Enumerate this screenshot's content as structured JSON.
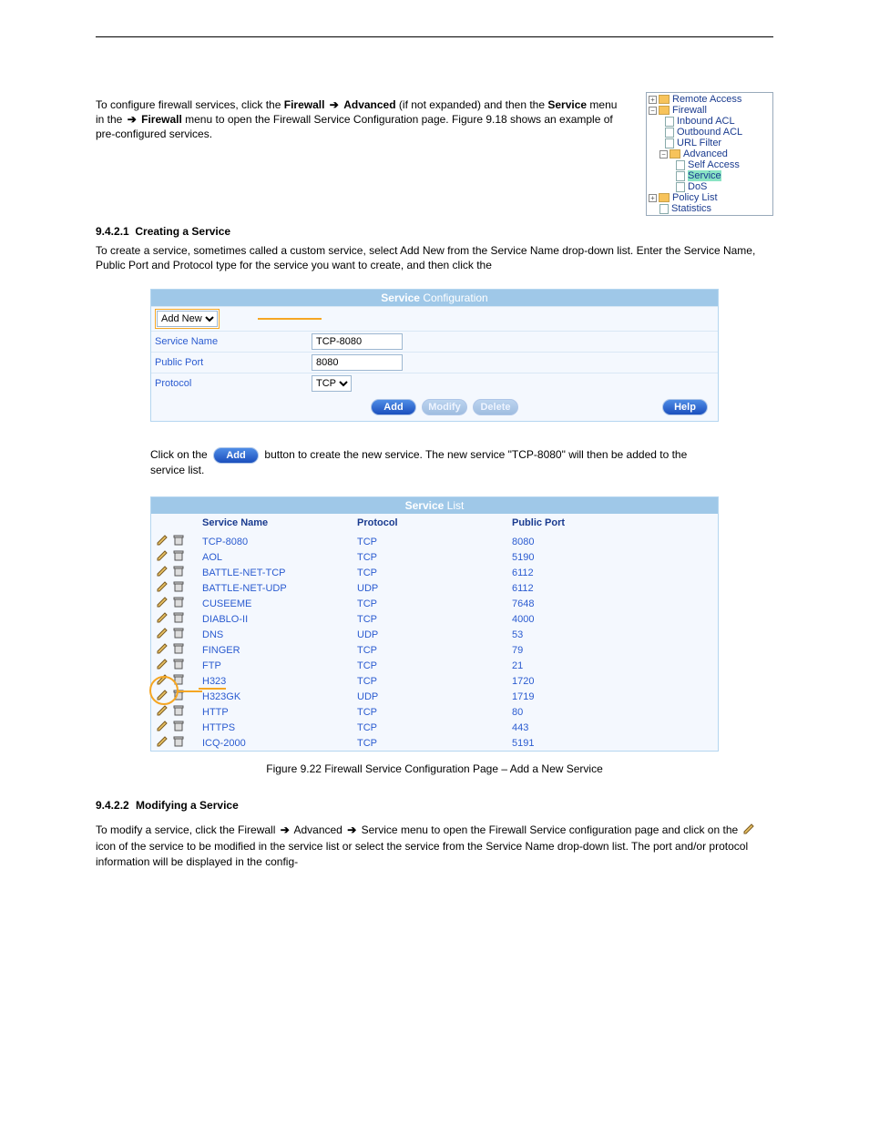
{
  "section": {
    "id": "9.4.2.1",
    "title": "Creating a Service",
    "para": "To create a service, sometimes called a custom service, select Add New from the Service Name drop-down list. Enter the Service Name, Public Port and Protocol type for the service you want to create, and then click the"
  },
  "tree": {
    "remote_access": "Remote Access",
    "firewall": "Firewall",
    "inbound_acl": "Inbound ACL",
    "outbound_acl": "Outbound ACL",
    "url_filter": "URL Filter",
    "advanced": "Advanced",
    "self_access": "Self Access",
    "service": "Service",
    "dos": "DoS",
    "policy_list": "Policy List",
    "statistics": "Statistics"
  },
  "intro": {
    "line1_a": "To configure firewall services, click the",
    "line1_b": "(if not expanded) and then the",
    "line1_c": "menu in the",
    "line2_a": "menu to open the Firewall Service Configuration page. Figure 9.18 shows an example of pre-configured services.",
    "firewall": "Firewall",
    "advanced": "Advanced",
    "service": "Service"
  },
  "config_panel": {
    "title_strong": "Service",
    "title_thin": "Configuration",
    "mode": "Add New",
    "fields": {
      "service_name_label": "Service Name",
      "service_name_value": "TCP-8080",
      "public_port_label": "Public Port",
      "public_port_value": "8080",
      "protocol_label": "Protocol",
      "protocol_value": "TCP"
    },
    "buttons": {
      "add": "Add",
      "modify": "Modify",
      "delete": "Delete",
      "help": "Help"
    }
  },
  "add_line": {
    "pre": "Click on the",
    "post": "button to create the new service. The new service \"TCP-8080\" will then be added to the service list.",
    "btn": "Add"
  },
  "figure_caption": "Figure 9.22 Firewall Service Configuration Page – Add a New Service",
  "list_panel": {
    "title_strong": "Service",
    "title_thin": "List",
    "cols": {
      "name": "Service Name",
      "proto": "Protocol",
      "port": "Public Port"
    },
    "rows": [
      {
        "name": "TCP-8080",
        "proto": "TCP",
        "port": "8080"
      },
      {
        "name": "AOL",
        "proto": "TCP",
        "port": "5190"
      },
      {
        "name": "BATTLE-NET-TCP",
        "proto": "TCP",
        "port": "6112"
      },
      {
        "name": "BATTLE-NET-UDP",
        "proto": "UDP",
        "port": "6112"
      },
      {
        "name": "CUSEEME",
        "proto": "TCP",
        "port": "7648"
      },
      {
        "name": "DIABLO-II",
        "proto": "TCP",
        "port": "4000"
      },
      {
        "name": "DNS",
        "proto": "UDP",
        "port": "53"
      },
      {
        "name": "FINGER",
        "proto": "TCP",
        "port": "79"
      },
      {
        "name": "FTP",
        "proto": "TCP",
        "port": "21"
      },
      {
        "name": "H323",
        "proto": "TCP",
        "port": "1720"
      },
      {
        "name": "H323GK",
        "proto": "UDP",
        "port": "1719"
      },
      {
        "name": "HTTP",
        "proto": "TCP",
        "port": "80"
      },
      {
        "name": "HTTPS",
        "proto": "TCP",
        "port": "443"
      },
      {
        "name": "ICQ-2000",
        "proto": "TCP",
        "port": "5191"
      }
    ]
  },
  "modify": {
    "heading_id": "9.4.2.2",
    "heading": "Modifying a Service",
    "p1_a": "To modify a service, click the Firewall",
    "p1_b": "Advanced",
    "p1_c": "Service menu to open the Firewall Service configuration page and click on the",
    "p1_d": "icon of the service to be modified in the service list or select the service from the Service Name drop-down list. The port and/or protocol information will be displayed in the config-",
    "arrow": "➜"
  }
}
